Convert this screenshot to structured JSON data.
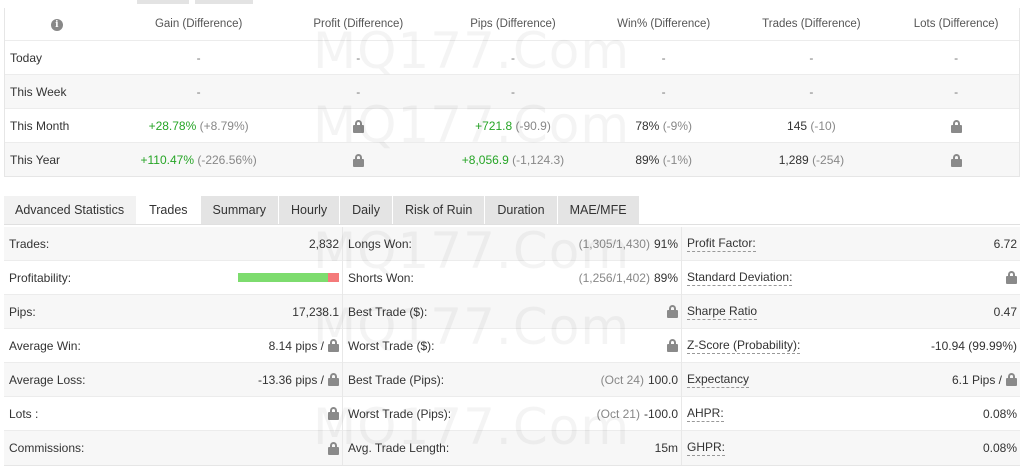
{
  "period_table": {
    "headers": [
      "Gain (Difference)",
      "Profit (Difference)",
      "Pips (Difference)",
      "Win% (Difference)",
      "Trades (Difference)",
      "Lots (Difference)"
    ],
    "rows": [
      {
        "label": "Today",
        "gain": {
          "main": "-",
          "diff": ""
        },
        "profit": "-",
        "pips": {
          "main": "-",
          "diff": ""
        },
        "win": {
          "main": "-",
          "diff": ""
        },
        "trades": {
          "main": "-",
          "diff": ""
        },
        "lots": "-"
      },
      {
        "label": "This Week",
        "gain": {
          "main": "-",
          "diff": ""
        },
        "profit": "-",
        "pips": {
          "main": "-",
          "diff": ""
        },
        "win": {
          "main": "-",
          "diff": ""
        },
        "trades": {
          "main": "-",
          "diff": ""
        },
        "lots": "-"
      },
      {
        "label": "This Month",
        "gain": {
          "main": "+28.78%",
          "diff": "(+8.79%)"
        },
        "profit": "lock",
        "pips": {
          "main": "+721.8",
          "diff": "(-90.9)"
        },
        "win": {
          "main": "78%",
          "diff": "(-9%)"
        },
        "trades": {
          "main": "145",
          "diff": "(-10)"
        },
        "lots": "lock"
      },
      {
        "label": "This Year",
        "gain": {
          "main": "+110.47%",
          "diff": "(-226.56%)"
        },
        "profit": "lock",
        "pips": {
          "main": "+8,056.9",
          "diff": "(-1,124.3)"
        },
        "win": {
          "main": "89%",
          "diff": "(-1%)"
        },
        "trades": {
          "main": "1,289",
          "diff": "(-254)"
        },
        "lots": "lock"
      }
    ]
  },
  "tabs": {
    "title": "Advanced Statistics",
    "items": [
      "Trades",
      "Summary",
      "Hourly",
      "Daily",
      "Risk of Ruin",
      "Duration",
      "MAE/MFE"
    ],
    "active": "Trades"
  },
  "stats": {
    "col1": [
      {
        "label": "Trades:",
        "value": "2,832"
      },
      {
        "label": "Profitability:",
        "value": "",
        "bar_win_fraction": 0.89
      },
      {
        "label": "Pips:",
        "value": "17,238.1"
      },
      {
        "label": "Average Win:",
        "value": "8.14 pips /"
      },
      {
        "label": "Average Loss:",
        "value": "-13.36 pips /"
      },
      {
        "label": "Lots :",
        "value": ""
      },
      {
        "label": "Commissions:",
        "value": ""
      }
    ],
    "col2": [
      {
        "label": "Longs Won:",
        "muted": "(1,305/1,430)",
        "value": "91%"
      },
      {
        "label": "Shorts Won:",
        "muted": "(1,256/1,402)",
        "value": "89%"
      },
      {
        "label": "Best Trade ($):",
        "muted": "",
        "value": ""
      },
      {
        "label": "Worst Trade ($):",
        "muted": "",
        "value": ""
      },
      {
        "label": "Best Trade (Pips):",
        "muted": "(Oct 24)",
        "value": "100.0"
      },
      {
        "label": "Worst Trade (Pips):",
        "muted": "(Oct 21)",
        "value": "-100.0"
      },
      {
        "label": "Avg. Trade Length:",
        "muted": "",
        "value": "15m"
      }
    ],
    "col3": [
      {
        "label": "Profit Factor:",
        "value": "6.72"
      },
      {
        "label": "Standard Deviation:",
        "value": ""
      },
      {
        "label": "Sharpe Ratio",
        "value": "0.47"
      },
      {
        "label": "Z-Score (Probability):",
        "value": "-10.94 (99.99%)"
      },
      {
        "label": "Expectancy",
        "value": "6.1 Pips /"
      },
      {
        "label": "AHPR:",
        "value": "0.08%"
      },
      {
        "label": "GHPR:",
        "value": "0.08%"
      }
    ]
  },
  "watermark": "MQ177.Com",
  "colors": {
    "positive": "#26a526",
    "bar_good": "#7ddc6e",
    "bar_bad": "#f47a7a",
    "lock": "#8a8a8a"
  }
}
